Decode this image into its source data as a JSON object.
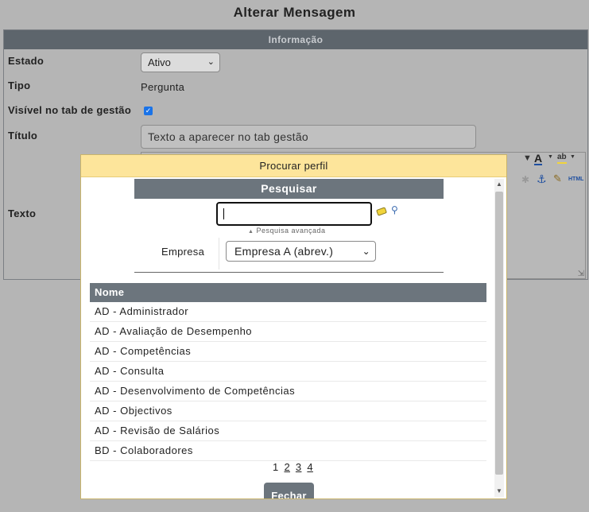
{
  "page": {
    "title": "Alterar Mensagem"
  },
  "form": {
    "section_title": "Informação",
    "estado": {
      "label": "Estado",
      "value": "Ativo"
    },
    "tipo": {
      "label": "Tipo",
      "value": "Pergunta"
    },
    "visivel": {
      "label": "Visível no tab de gestão",
      "checked": true
    },
    "titulo": {
      "label": "Título",
      "value": "Texto a aparecer no tab gestão"
    },
    "texto": {
      "label": "Texto"
    }
  },
  "editor_toolbar": {
    "icons": [
      "font-color-icon",
      "highlight-icon",
      "anchor-icon",
      "clean-format-icon",
      "html-source-icon"
    ],
    "html_label": "HTML",
    "colors": {
      "font_color": "#1f4fa0",
      "highlight": "#f1d43b"
    }
  },
  "modal": {
    "title": "Procurar perfil",
    "search": {
      "title": "Pesquisar",
      "input_value": "",
      "advanced_label": "Pesquisa avançada",
      "empresa_label": "Empresa",
      "empresa_value": "Empresa A (abrev.)"
    },
    "results": {
      "column": "Nome",
      "items": [
        "AD - Administrador",
        "AD - Avaliação de Desempenho",
        "AD - Competências",
        "AD - Consulta",
        "AD - Desenvolvimento de Competências",
        "AD - Objectivos",
        "AD - Revisão de Salários",
        "BD - Colaboradores"
      ]
    },
    "pagination": {
      "current": "1",
      "pages": [
        "2",
        "3",
        "4"
      ]
    },
    "close_label": "Fechar"
  },
  "colors": {
    "overlay_bg": "#b5b5b5",
    "panel_header": "#5d656c",
    "modal_header": "#fde59b",
    "table_header": "#6c757d",
    "checkbox": "#1a73e8"
  }
}
